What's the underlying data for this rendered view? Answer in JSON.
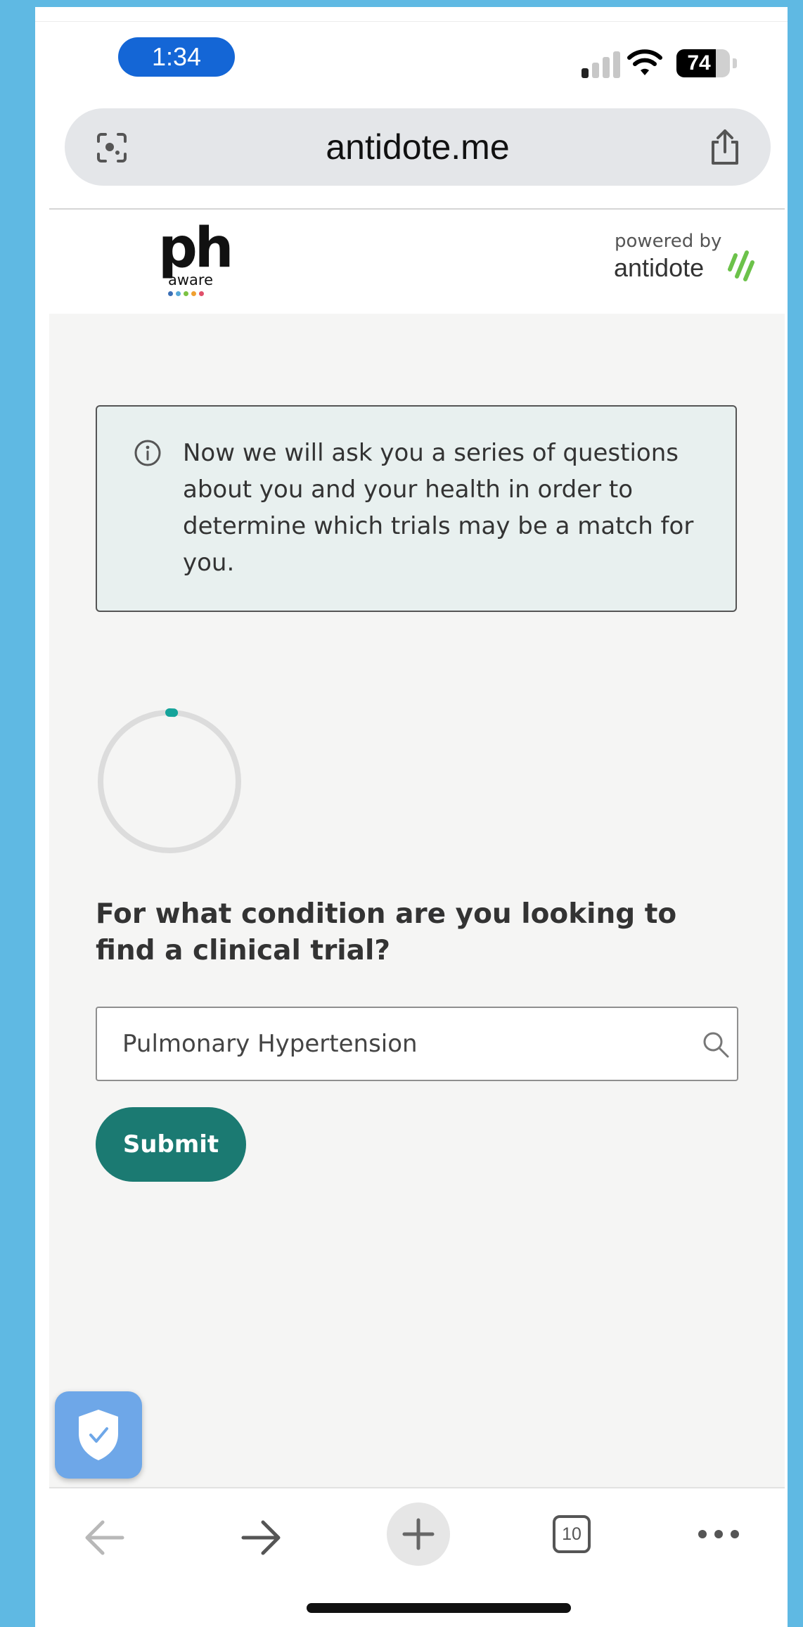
{
  "status_bar": {
    "time": "1:34",
    "battery": "74",
    "battery_level": 0.74
  },
  "browser": {
    "url": "antidote.me",
    "open_tabs": "10"
  },
  "header": {
    "logo": {
      "text": "ph",
      "subtext": "aware",
      "dot_colors": [
        "#3b6fb6",
        "#56a8d8",
        "#7cc242",
        "#f0a030",
        "#e0506a"
      ]
    },
    "powered_by": "powered by",
    "brand": "antidote",
    "brand_color": "#6cc24a"
  },
  "main": {
    "info_text": "Now we will ask you a series of questions about you and your health in order to determine which trials may be a match for you.",
    "progress_fraction": 0.01,
    "question": "For what condition are you looking to find a clinical trial?",
    "condition_value": "Pulmonary Hypertension",
    "submit_label": "Submit"
  },
  "colors": {
    "accent": "#1b7a72",
    "progress": "#14a39a",
    "background": "#f5f5f4",
    "info_bg": "#e8f0ef",
    "url_bar": "#e4e6e9"
  },
  "icons": [
    "screen-lens-icon",
    "share-icon",
    "info-icon",
    "search-icon",
    "shield-check-icon",
    "back-arrow-icon",
    "forward-arrow-icon",
    "plus-icon",
    "tabs-icon",
    "more-icon"
  ]
}
